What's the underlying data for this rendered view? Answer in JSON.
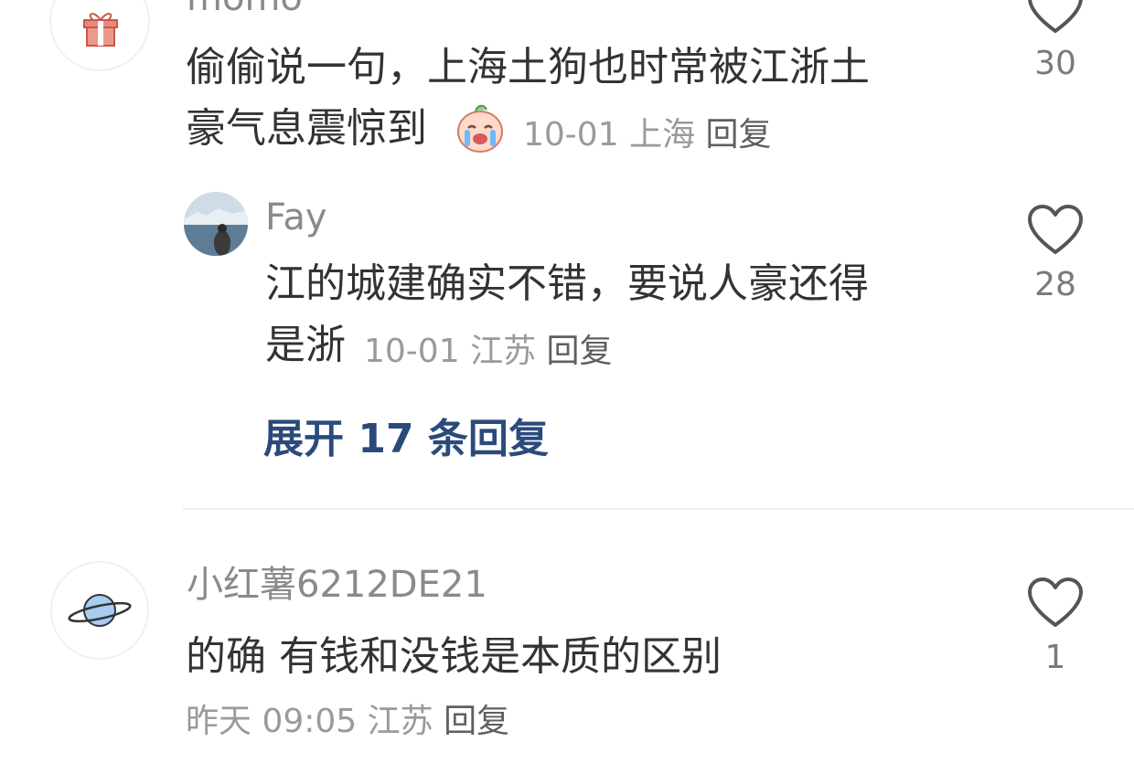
{
  "comments": [
    {
      "username": "momo",
      "text_line1": "偷偷说一句，上海土狗也时常被江浙土",
      "text_line2": "豪气息震惊到",
      "date": "10-01",
      "location": "上海",
      "reply_label": "回复",
      "likes": "30",
      "avatar_icon": "gift-icon",
      "emoji_icon": "crying-peach-emoji-icon"
    },
    {
      "username": "Fay",
      "text_line1": "江的城建确实不错，要说人豪还得",
      "text_line2": "是浙",
      "date": "10-01",
      "location": "江苏",
      "reply_label": "回复",
      "likes": "28",
      "avatar_icon": "photo-avatar"
    },
    {
      "username": "小红薯6212DE21",
      "text_line1": "的确 有钱和没钱是本质的区别",
      "date": "昨天 09:05",
      "location": "江苏",
      "reply_label": "回复",
      "likes": "1",
      "avatar_icon": "planet-icon"
    }
  ],
  "expand_replies": "展开 17 条回复",
  "colors": {
    "expand_link": "#2b4a7c",
    "meta_text": "#9a9a9a",
    "username": "#8a8a8a",
    "body_text": "#333333"
  }
}
